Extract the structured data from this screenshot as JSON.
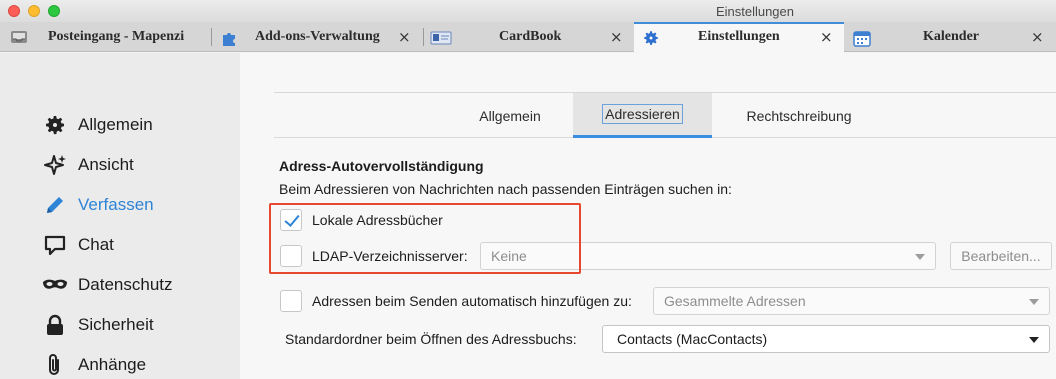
{
  "window": {
    "title": "Einstellungen"
  },
  "tabs": [
    {
      "label": "Posteingang - Mapenzi",
      "icon": "inbox-icon"
    },
    {
      "label": "Add-ons-Verwaltung",
      "icon": "puzzle-icon",
      "close": "×"
    },
    {
      "label": "CardBook",
      "icon": "cardbook-icon",
      "close": "×"
    },
    {
      "label": "Einstellungen",
      "icon": "gear-icon",
      "close": "×",
      "active": true
    },
    {
      "label": "Kalender",
      "icon": "calendar-icon",
      "close": "×"
    }
  ],
  "sidebar": {
    "items": [
      {
        "label": "Allgemein",
        "icon": "gear-icon"
      },
      {
        "label": "Ansicht",
        "icon": "sparkle-icon"
      },
      {
        "label": "Verfassen",
        "icon": "pencil-icon",
        "active": true
      },
      {
        "label": "Chat",
        "icon": "chat-bubble-icon"
      },
      {
        "label": "Datenschutz",
        "icon": "mask-icon"
      },
      {
        "label": "Sicherheit",
        "icon": "lock-icon"
      },
      {
        "label": "Anhänge",
        "icon": "paperclip-icon"
      }
    ]
  },
  "subtabs": [
    {
      "label": "Allgemein"
    },
    {
      "label": "Adressieren",
      "active": true
    },
    {
      "label": "Rechtschreibung"
    }
  ],
  "addressing": {
    "title": "Adress-Autovervollständigung",
    "description": "Beim Adressieren von Nachrichten nach passenden Einträgen suchen in:",
    "local_books": {
      "label": "Lokale Adressbücher",
      "checked": true
    },
    "ldap": {
      "label": "LDAP-Verzeichnisserver:",
      "checked": false,
      "select_value": "Keine",
      "edit_button": "Bearbeiten..."
    },
    "auto_add": {
      "label": "Adressen beim Senden automatisch hinzufügen zu:",
      "checked": false,
      "select_value": "Gesammelte Adressen"
    },
    "default_folder": {
      "label": "Standardordner beim Öffnen des Adressbuchs:",
      "select_value": "Contacts (MacContacts)"
    }
  },
  "colors": {
    "accent": "#2e84d6",
    "highlight": "#e5472f"
  }
}
